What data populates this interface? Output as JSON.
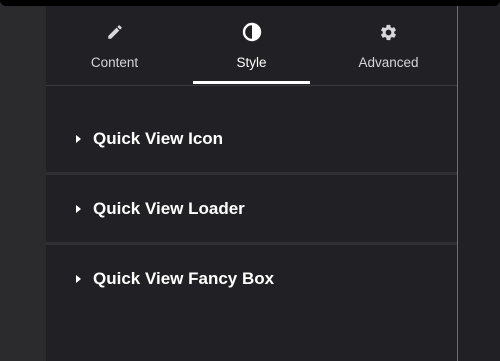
{
  "tabs": [
    {
      "label": "Content",
      "icon": "pencil-icon"
    },
    {
      "label": "Style",
      "icon": "contrast-icon",
      "active": true
    },
    {
      "label": "Advanced",
      "icon": "gear-icon"
    }
  ],
  "sections": [
    {
      "title": "Quick View Icon"
    },
    {
      "title": "Quick View Loader"
    },
    {
      "title": "Quick View Fancy Box"
    }
  ],
  "colors": {
    "panel_bg": "#212125",
    "active_indicator": "#ffffff",
    "text": "#ffffff",
    "tab_text": "#d5d5d9"
  }
}
